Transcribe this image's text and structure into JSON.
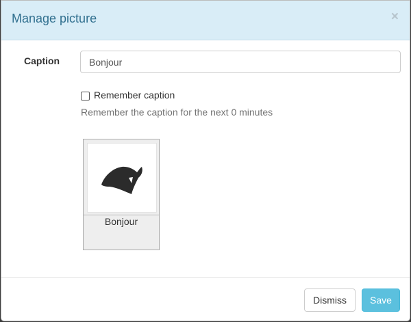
{
  "dialog": {
    "title": "Manage picture",
    "close_symbol": "×",
    "close_icon": "close-icon"
  },
  "form": {
    "caption_label": "Caption",
    "caption_value": "Bonjour",
    "remember_checked": false,
    "remember_label": "Remember caption",
    "help_text": "Remember the caption for the next 0 minutes"
  },
  "thumbnail": {
    "image_icon": "bird-head-silhouette",
    "caption": "Bonjour"
  },
  "footer": {
    "dismiss_label": "Dismiss",
    "save_label": "Save"
  },
  "colors": {
    "header_bg": "#d9edf7",
    "title_color": "#31708f",
    "save_bg": "#5bc0de"
  }
}
